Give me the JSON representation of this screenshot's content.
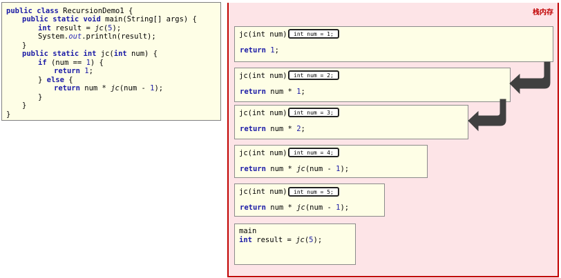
{
  "code": {
    "class_decl": "public class RecursionDemo1 {",
    "main_sig": "public static void main(String[] args) {",
    "result_decl": "int result = jc(5);",
    "println": "System.out.println(result);",
    "close1": "}",
    "jc_sig": "public static int jc(int num) {",
    "if_line": "if (num == 1) {",
    "return1": "return 1;",
    "else_line": "} else {",
    "return_rec": "return num * jc(num - 1);",
    "close2": "}",
    "close3": "}",
    "close4": "}"
  },
  "stack": {
    "label": "栈内存",
    "frames": [
      {
        "sig": "jc(int num)",
        "tag": "int num = 1;",
        "body": "return 1;"
      },
      {
        "sig": "jc(int num)",
        "tag": "int num = 2;",
        "body": "return num * 1;"
      },
      {
        "sig": "jc(int num)",
        "tag": "int num = 3;",
        "body": "return num * 2;"
      },
      {
        "sig": "jc(int num)",
        "tag": "int num = 4;",
        "body": "return num * jc(num - 1);"
      },
      {
        "sig": "jc(int num)",
        "tag": "int num = 5;",
        "body": "return num * jc(num - 1);"
      }
    ],
    "main": {
      "name": "main",
      "body": "int result = jc(5);"
    }
  },
  "colors": {
    "stack_bg": "#fde4e7",
    "stack_border": "#c00000",
    "frame_bg": "#fefee6",
    "arrow": "#404040",
    "keyword": "#1a1aa6"
  }
}
